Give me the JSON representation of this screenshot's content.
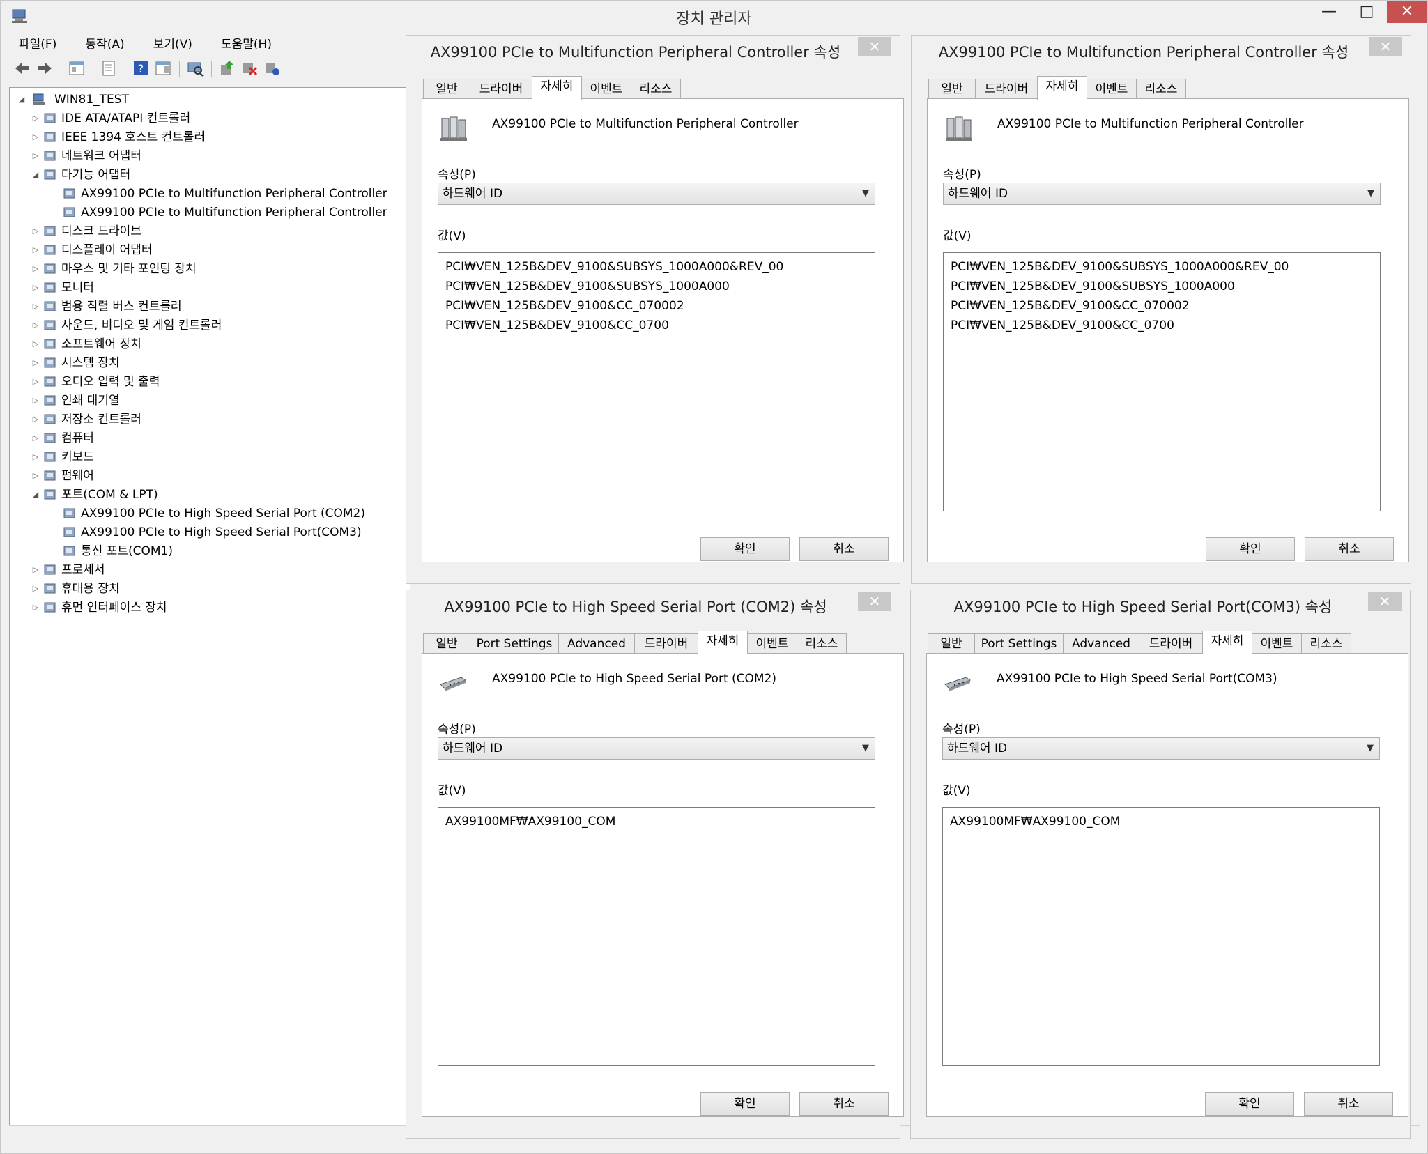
{
  "window": {
    "title": "장치 관리자",
    "minimize": "—",
    "maximize": "□",
    "close": "✕"
  },
  "menu": [
    "파일(F)",
    "동작(A)",
    "보기(V)",
    "도움말(H)"
  ],
  "tree": {
    "root": "WIN81_TEST",
    "nodes": [
      {
        "label": "IDE ATA/ATAPI 컨트롤러",
        "level": 1,
        "toggle": "▷",
        "icon": "ide-controller-icon"
      },
      {
        "label": "IEEE 1394 호스트 컨트롤러",
        "level": 1,
        "toggle": "▷",
        "icon": "firewire-icon"
      },
      {
        "label": "네트워크 어댑터",
        "level": 1,
        "toggle": "▷",
        "icon": "network-adapter-icon"
      },
      {
        "label": "다기능 어댑터",
        "level": 1,
        "toggle": "◢",
        "icon": "multifunction-adapter-icon"
      },
      {
        "label": "AX99100 PCIe to Multifunction Peripheral Controller",
        "level": 2,
        "toggle": "",
        "icon": "multifunction-device-icon"
      },
      {
        "label": "AX99100 PCIe to Multifunction Peripheral Controller",
        "level": 2,
        "toggle": "",
        "icon": "multifunction-device-icon"
      },
      {
        "label": "디스크 드라이브",
        "level": 1,
        "toggle": "▷",
        "icon": "disk-drive-icon"
      },
      {
        "label": "디스플레이 어댑터",
        "level": 1,
        "toggle": "▷",
        "icon": "display-adapter-icon"
      },
      {
        "label": "마우스 및 기타 포인팅 장치",
        "level": 1,
        "toggle": "▷",
        "icon": "mouse-icon"
      },
      {
        "label": "모니터",
        "level": 1,
        "toggle": "▷",
        "icon": "monitor-icon"
      },
      {
        "label": "범용 직렬 버스 컨트롤러",
        "level": 1,
        "toggle": "▷",
        "icon": "usb-icon"
      },
      {
        "label": "사운드, 비디오 및 게임 컨트롤러",
        "level": 1,
        "toggle": "▷",
        "icon": "sound-icon"
      },
      {
        "label": "소프트웨어 장치",
        "level": 1,
        "toggle": "▷",
        "icon": "software-device-icon"
      },
      {
        "label": "시스템 장치",
        "level": 1,
        "toggle": "▷",
        "icon": "system-device-icon"
      },
      {
        "label": "오디오 입력 및 출력",
        "level": 1,
        "toggle": "▷",
        "icon": "audio-io-icon"
      },
      {
        "label": "인쇄 대기열",
        "level": 1,
        "toggle": "▷",
        "icon": "printer-icon"
      },
      {
        "label": "저장소 컨트롤러",
        "level": 1,
        "toggle": "▷",
        "icon": "storage-controller-icon"
      },
      {
        "label": "컴퓨터",
        "level": 1,
        "toggle": "▷",
        "icon": "computer-icon"
      },
      {
        "label": "키보드",
        "level": 1,
        "toggle": "▷",
        "icon": "keyboard-icon"
      },
      {
        "label": "펌웨어",
        "level": 1,
        "toggle": "▷",
        "icon": "firmware-icon"
      },
      {
        "label": "포트(COM & LPT)",
        "level": 1,
        "toggle": "◢",
        "icon": "port-icon"
      },
      {
        "label": "AX99100 PCIe to High Speed Serial Port (COM2)",
        "level": 2,
        "toggle": "",
        "icon": "port-icon"
      },
      {
        "label": "AX99100 PCIe to High Speed Serial Port(COM3)",
        "level": 2,
        "toggle": "",
        "icon": "port-icon"
      },
      {
        "label": "통신 포트(COM1)",
        "level": 2,
        "toggle": "",
        "icon": "port-icon"
      },
      {
        "label": "프로세서",
        "level": 1,
        "toggle": "▷",
        "icon": "processor-icon"
      },
      {
        "label": "휴대용 장치",
        "level": 1,
        "toggle": "▷",
        "icon": "portable-device-icon"
      },
      {
        "label": "휴먼 인터페이스 장치",
        "level": 1,
        "toggle": "▷",
        "icon": "hid-icon"
      }
    ]
  },
  "dialogs": [
    {
      "title": "AX99100 PCIe to Multifunction Peripheral Controller 속성",
      "tabs": [
        "일반",
        "드라이버",
        "자세히",
        "이벤트",
        "리소스"
      ],
      "active_tab": "자세히",
      "device_name": "AX99100 PCIe to Multifunction Peripheral Controller",
      "device_icon": "multifunction-device-icon",
      "property_label": "속성(P)",
      "property_value": "하드웨어 ID",
      "value_label": "값(V)",
      "values": [
        "PCI₩VEN_125B&DEV_9100&SUBSYS_1000A000&REV_00",
        "PCI₩VEN_125B&DEV_9100&SUBSYS_1000A000",
        "PCI₩VEN_125B&DEV_9100&CC_070002",
        "PCI₩VEN_125B&DEV_9100&CC_0700"
      ],
      "ok": "확인",
      "cancel": "취소"
    },
    {
      "title": "AX99100 PCIe to Multifunction Peripheral Controller 속성",
      "tabs": [
        "일반",
        "드라이버",
        "자세히",
        "이벤트",
        "리소스"
      ],
      "active_tab": "자세히",
      "device_name": "AX99100 PCIe to Multifunction Peripheral Controller",
      "device_icon": "multifunction-device-icon",
      "property_label": "속성(P)",
      "property_value": "하드웨어 ID",
      "value_label": "값(V)",
      "values": [
        "PCI₩VEN_125B&DEV_9100&SUBSYS_1000A000&REV_00",
        "PCI₩VEN_125B&DEV_9100&SUBSYS_1000A000",
        "PCI₩VEN_125B&DEV_9100&CC_070002",
        "PCI₩VEN_125B&DEV_9100&CC_0700"
      ],
      "ok": "확인",
      "cancel": "취소"
    },
    {
      "title": "AX99100 PCIe to High Speed Serial Port (COM2) 속성",
      "tabs": [
        "일반",
        "Port Settings",
        "Advanced",
        "드라이버",
        "자세히",
        "이벤트",
        "리소스"
      ],
      "active_tab": "자세히",
      "device_name": "AX99100 PCIe to High Speed Serial Port (COM2)",
      "device_icon": "serial-port-icon",
      "property_label": "속성(P)",
      "property_value": "하드웨어 ID",
      "value_label": "값(V)",
      "values": [
        "AX99100MF₩AX99100_COM"
      ],
      "ok": "확인",
      "cancel": "취소"
    },
    {
      "title": "AX99100 PCIe to High Speed Serial Port(COM3) 속성",
      "tabs": [
        "일반",
        "Port Settings",
        "Advanced",
        "드라이버",
        "자세히",
        "이벤트",
        "리소스"
      ],
      "active_tab": "자세히",
      "device_name": "AX99100 PCIe to High Speed Serial Port(COM3)",
      "device_icon": "serial-port-icon",
      "property_label": "속성(P)",
      "property_value": "하드웨어 ID",
      "value_label": "값(V)",
      "values": [
        "AX99100MF₩AX99100_COM"
      ],
      "ok": "확인",
      "cancel": "취소"
    }
  ],
  "colors": {
    "window_bg": "#f0f0f0",
    "close_red": "#c75050",
    "dialog_close": "#c8c8c8",
    "border": "#adadad"
  }
}
